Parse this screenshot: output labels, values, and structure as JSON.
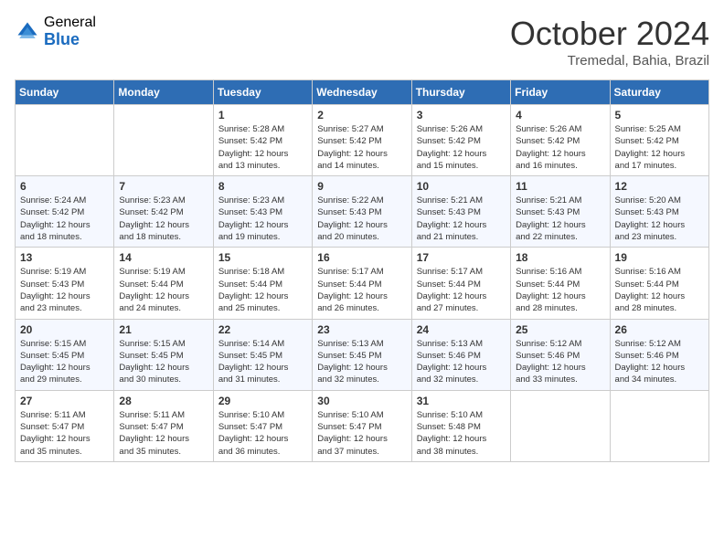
{
  "header": {
    "logo_general": "General",
    "logo_blue": "Blue",
    "month": "October 2024",
    "location": "Tremedal, Bahia, Brazil"
  },
  "days_of_week": [
    "Sunday",
    "Monday",
    "Tuesday",
    "Wednesday",
    "Thursday",
    "Friday",
    "Saturday"
  ],
  "weeks": [
    [
      null,
      null,
      {
        "day": 1,
        "sunrise": "5:28 AM",
        "sunset": "5:42 PM",
        "daylight": "12 hours and 13 minutes."
      },
      {
        "day": 2,
        "sunrise": "5:27 AM",
        "sunset": "5:42 PM",
        "daylight": "12 hours and 14 minutes."
      },
      {
        "day": 3,
        "sunrise": "5:26 AM",
        "sunset": "5:42 PM",
        "daylight": "12 hours and 15 minutes."
      },
      {
        "day": 4,
        "sunrise": "5:26 AM",
        "sunset": "5:42 PM",
        "daylight": "12 hours and 16 minutes."
      },
      {
        "day": 5,
        "sunrise": "5:25 AM",
        "sunset": "5:42 PM",
        "daylight": "12 hours and 17 minutes."
      }
    ],
    [
      {
        "day": 6,
        "sunrise": "5:24 AM",
        "sunset": "5:42 PM",
        "daylight": "12 hours and 18 minutes."
      },
      {
        "day": 7,
        "sunrise": "5:23 AM",
        "sunset": "5:42 PM",
        "daylight": "12 hours and 18 minutes."
      },
      {
        "day": 8,
        "sunrise": "5:23 AM",
        "sunset": "5:43 PM",
        "daylight": "12 hours and 19 minutes."
      },
      {
        "day": 9,
        "sunrise": "5:22 AM",
        "sunset": "5:43 PM",
        "daylight": "12 hours and 20 minutes."
      },
      {
        "day": 10,
        "sunrise": "5:21 AM",
        "sunset": "5:43 PM",
        "daylight": "12 hours and 21 minutes."
      },
      {
        "day": 11,
        "sunrise": "5:21 AM",
        "sunset": "5:43 PM",
        "daylight": "12 hours and 22 minutes."
      },
      {
        "day": 12,
        "sunrise": "5:20 AM",
        "sunset": "5:43 PM",
        "daylight": "12 hours and 23 minutes."
      }
    ],
    [
      {
        "day": 13,
        "sunrise": "5:19 AM",
        "sunset": "5:43 PM",
        "daylight": "12 hours and 23 minutes."
      },
      {
        "day": 14,
        "sunrise": "5:19 AM",
        "sunset": "5:44 PM",
        "daylight": "12 hours and 24 minutes."
      },
      {
        "day": 15,
        "sunrise": "5:18 AM",
        "sunset": "5:44 PM",
        "daylight": "12 hours and 25 minutes."
      },
      {
        "day": 16,
        "sunrise": "5:17 AM",
        "sunset": "5:44 PM",
        "daylight": "12 hours and 26 minutes."
      },
      {
        "day": 17,
        "sunrise": "5:17 AM",
        "sunset": "5:44 PM",
        "daylight": "12 hours and 27 minutes."
      },
      {
        "day": 18,
        "sunrise": "5:16 AM",
        "sunset": "5:44 PM",
        "daylight": "12 hours and 28 minutes."
      },
      {
        "day": 19,
        "sunrise": "5:16 AM",
        "sunset": "5:44 PM",
        "daylight": "12 hours and 28 minutes."
      }
    ],
    [
      {
        "day": 20,
        "sunrise": "5:15 AM",
        "sunset": "5:45 PM",
        "daylight": "12 hours and 29 minutes."
      },
      {
        "day": 21,
        "sunrise": "5:15 AM",
        "sunset": "5:45 PM",
        "daylight": "12 hours and 30 minutes."
      },
      {
        "day": 22,
        "sunrise": "5:14 AM",
        "sunset": "5:45 PM",
        "daylight": "12 hours and 31 minutes."
      },
      {
        "day": 23,
        "sunrise": "5:13 AM",
        "sunset": "5:45 PM",
        "daylight": "12 hours and 32 minutes."
      },
      {
        "day": 24,
        "sunrise": "5:13 AM",
        "sunset": "5:46 PM",
        "daylight": "12 hours and 32 minutes."
      },
      {
        "day": 25,
        "sunrise": "5:12 AM",
        "sunset": "5:46 PM",
        "daylight": "12 hours and 33 minutes."
      },
      {
        "day": 26,
        "sunrise": "5:12 AM",
        "sunset": "5:46 PM",
        "daylight": "12 hours and 34 minutes."
      }
    ],
    [
      {
        "day": 27,
        "sunrise": "5:11 AM",
        "sunset": "5:47 PM",
        "daylight": "12 hours and 35 minutes."
      },
      {
        "day": 28,
        "sunrise": "5:11 AM",
        "sunset": "5:47 PM",
        "daylight": "12 hours and 35 minutes."
      },
      {
        "day": 29,
        "sunrise": "5:10 AM",
        "sunset": "5:47 PM",
        "daylight": "12 hours and 36 minutes."
      },
      {
        "day": 30,
        "sunrise": "5:10 AM",
        "sunset": "5:47 PM",
        "daylight": "12 hours and 37 minutes."
      },
      {
        "day": 31,
        "sunrise": "5:10 AM",
        "sunset": "5:48 PM",
        "daylight": "12 hours and 38 minutes."
      },
      null,
      null
    ]
  ]
}
